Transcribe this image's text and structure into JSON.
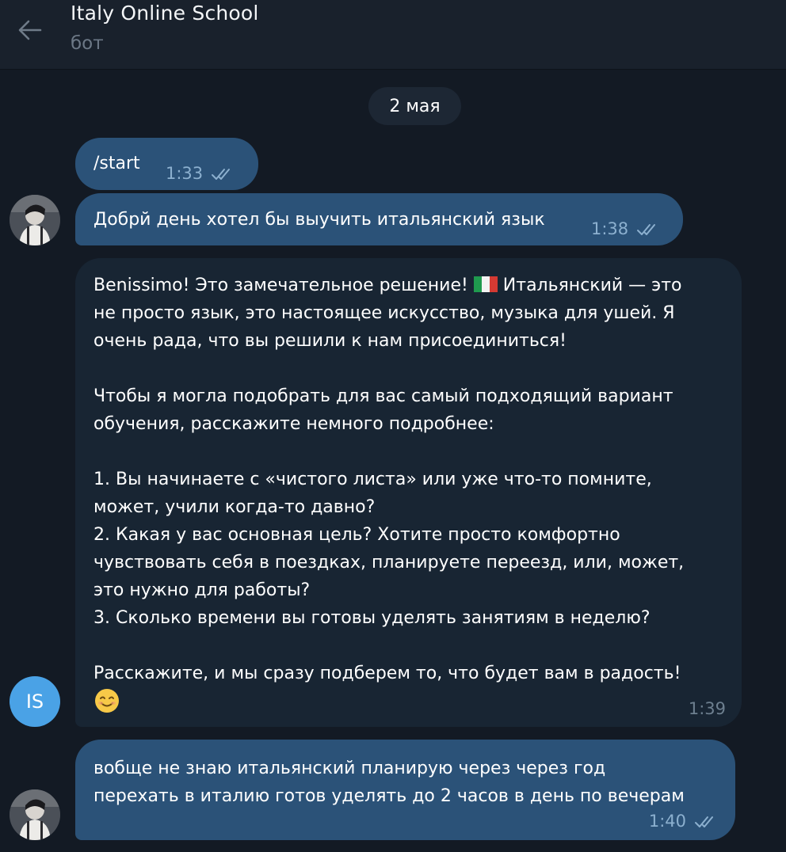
{
  "header": {
    "title": "Italy Online School",
    "subtitle": "бот"
  },
  "date_separator": "2 мая",
  "messages": [
    {
      "direction": "out",
      "text": "/start",
      "time": "1:33",
      "status": "read"
    },
    {
      "direction": "out",
      "text": "Добрй день хотел бы выучить итальянский язык",
      "time": "1:38",
      "status": "read"
    },
    {
      "direction": "in",
      "line1_before_flag": "Benissimo! Это замечательное решение! ",
      "flag_icon": "italy-flag",
      "line1_after_flag": " Итальянский — это",
      "text_rest": "не просто язык, это настоящее искусство, музыка для ушей. Я\nочень рада, что вы решили к нам присоединиться!\n\nЧтобы я могла подобрать для вас самый подходящий вариант\nобучения, расскажите немного подробнее:\n\n1. Вы начинаете с «чистого листа» или уже что-то помните,\nможет, учили когда-то давно?\n2. Какая у вас основная цель? Хотите просто комфортно\nчувствовать себя в поездках, планируете переезд, или, может,\nэто нужно для работы?\n3. Сколько времени вы готовы уделять занятиям в неделю?\n\nРасскажите, и мы сразу подберем то, что будет вам в радость!",
      "emoji_icon": "smiling-face",
      "time": "1:39",
      "avatar_initials": "IS"
    },
    {
      "direction": "out",
      "text": "вобще не знаю итальянский планирую через через год\nперехать в италию готов уделять до 2 часов в день по вечерам",
      "time": "1:40",
      "status": "read"
    }
  ],
  "colors": {
    "background": "#131a24",
    "header": "#19212c",
    "outgoing_bubble": "#2b5278",
    "incoming_bubble": "#182533",
    "bot_avatar": "#4aa2e6",
    "read_ticks": "#8cb0cf"
  }
}
